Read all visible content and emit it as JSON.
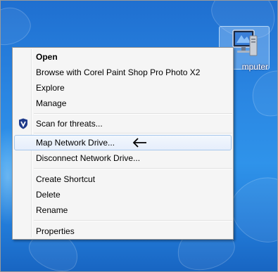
{
  "desktop": {
    "icon_label": "mputer"
  },
  "context_menu": {
    "items": [
      {
        "label": "Open"
      },
      {
        "label": "Browse with Corel Paint Shop Pro Photo X2"
      },
      {
        "label": "Explore"
      },
      {
        "label": "Manage"
      },
      {
        "label": "Scan for threats...",
        "icon": "shield-icon"
      },
      {
        "label": "Map Network Drive...",
        "annotation": "arrow-left-icon"
      },
      {
        "label": "Disconnect Network Drive..."
      },
      {
        "label": "Create Shortcut"
      },
      {
        "label": "Delete"
      },
      {
        "label": "Rename"
      },
      {
        "label": "Properties"
      }
    ]
  },
  "colors": {
    "desktop_background": "#2a86e2",
    "menu_background": "#f5f5f5",
    "hover_border": "#a8c8ec",
    "shield": "#1e3a8a"
  }
}
